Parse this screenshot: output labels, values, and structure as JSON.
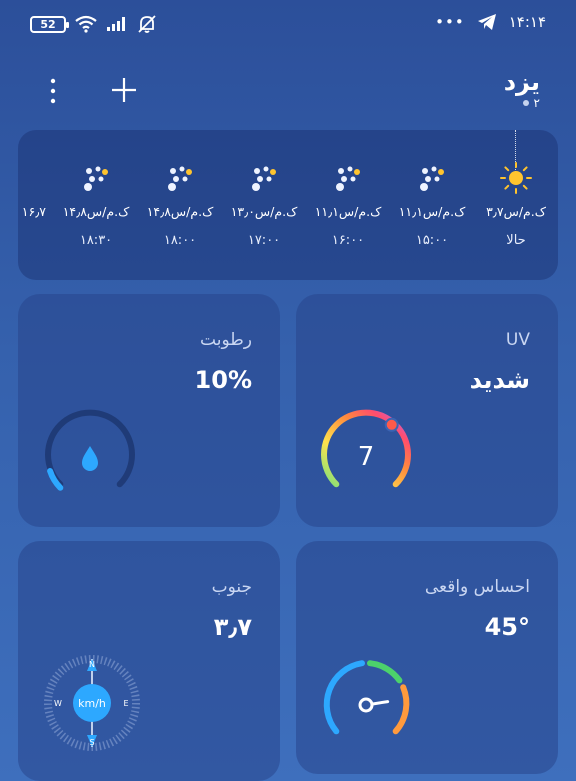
{
  "status_bar": {
    "battery": "52",
    "time": "۱۴:۱۴",
    "dots": "•••"
  },
  "header": {
    "city": "یزد",
    "city_index": "۲"
  },
  "hourly": [
    {
      "speed": "۳٫۷ک.م/س",
      "time": "حالا",
      "icon": "sun-icon"
    },
    {
      "speed": "۱۱٫۱ک.م/س",
      "time": "۱۵:۰۰",
      "icon": "night-partly-icon"
    },
    {
      "speed": "۱۱٫۱ک.م/س",
      "time": "۱۶:۰۰",
      "icon": "night-partly-icon"
    },
    {
      "speed": "۱۳٫۰ک.م/س",
      "time": "۱۷:۰۰",
      "icon": "night-partly-icon"
    },
    {
      "speed": "۱۴٫۸ک.م/س",
      "time": "۱۸:۰۰",
      "icon": "night-partly-icon"
    },
    {
      "speed": "۱۴٫۸ک.م/س",
      "time": "۱۸:۳۰",
      "icon": "night-partly-icon"
    },
    {
      "speed": "۱۶٫۷",
      "time": "",
      "icon": ""
    }
  ],
  "cards": {
    "uv": {
      "title": "UV",
      "value": "شدید",
      "index": "7",
      "level": 0.64
    },
    "humidity": {
      "title": "رطوبت",
      "value": "10%",
      "level": 0.1
    },
    "wind": {
      "title": "جنوب",
      "value": "۳٫۷",
      "unit": "km/h",
      "compass": {
        "n": "N",
        "s": "S",
        "e": "E",
        "w": "W"
      }
    },
    "feels_like": {
      "title": "احساس واقعی",
      "value": "45°",
      "level": 0.8
    }
  }
}
